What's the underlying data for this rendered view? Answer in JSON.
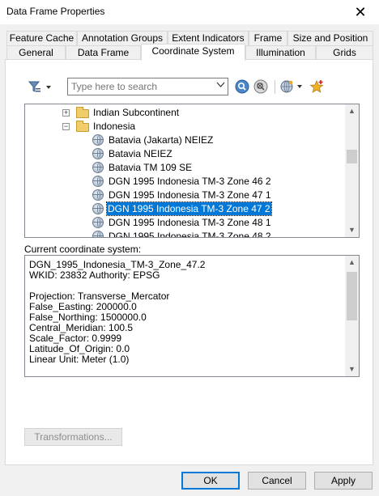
{
  "window": {
    "title": "Data Frame Properties"
  },
  "tabs_row1": [
    "Feature Cache",
    "Annotation Groups",
    "Extent Indicators",
    "Frame",
    "Size and Position"
  ],
  "tabs_row2": [
    "General",
    "Data Frame",
    "Coordinate System",
    "Illumination",
    "Grids"
  ],
  "search": {
    "placeholder": "Type here to search"
  },
  "tree": {
    "folders": [
      "Indian Subcontinent",
      "Indonesia"
    ],
    "items": [
      "Batavia (Jakarta) NEIEZ",
      "Batavia NEIEZ",
      "Batavia TM 109 SE",
      "DGN 1995 Indonesia TM-3 Zone 46 2",
      "DGN 1995 Indonesia TM-3 Zone 47 1",
      "DGN 1995 Indonesia TM-3 Zone 47 2",
      "DGN 1995 Indonesia TM-3 Zone 48 1",
      "DGN 1995 Indonesia TM-3 Zone 48 2"
    ],
    "selected": "DGN 1995 Indonesia TM-3 Zone 47 2"
  },
  "current": {
    "label": "Current coordinate system:",
    "lines": [
      "DGN_1995_Indonesia_TM-3_Zone_47.2",
      "WKID: 23832 Authority: EPSG",
      "",
      "Projection: Transverse_Mercator",
      "False_Easting: 200000.0",
      "False_Northing: 1500000.0",
      "Central_Meridian: 100.5",
      "Scale_Factor: 0.9999",
      "Latitude_Of_Origin: 0.0",
      "Linear Unit: Meter (1.0)"
    ]
  },
  "buttons": {
    "transformations": "Transformations...",
    "ok": "OK",
    "cancel": "Cancel",
    "apply": "Apply"
  }
}
